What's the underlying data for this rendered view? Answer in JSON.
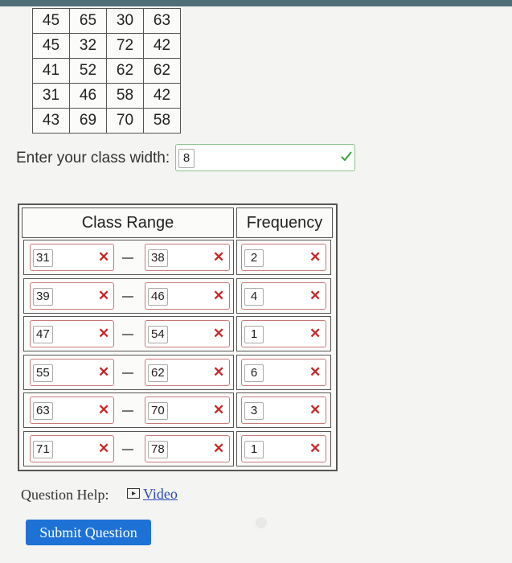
{
  "data_table": {
    "rows": [
      [
        "45",
        "65",
        "30",
        "63"
      ],
      [
        "45",
        "32",
        "72",
        "42"
      ],
      [
        "41",
        "52",
        "62",
        "62"
      ],
      [
        "31",
        "46",
        "58",
        "42"
      ],
      [
        "43",
        "69",
        "70",
        "58"
      ]
    ]
  },
  "class_width": {
    "label": "Enter your class width:",
    "value": "8",
    "status": "correct"
  },
  "freq_table": {
    "headers": {
      "range": "Class Range",
      "frequency": "Frequency"
    },
    "rows": [
      {
        "lower": "31",
        "upper": "38",
        "freq": "2"
      },
      {
        "lower": "39",
        "upper": "46",
        "freq": "4"
      },
      {
        "lower": "47",
        "upper": "54",
        "freq": "1"
      },
      {
        "lower": "55",
        "upper": "62",
        "freq": "6"
      },
      {
        "lower": "63",
        "upper": "70",
        "freq": "3"
      },
      {
        "lower": "71",
        "upper": "78",
        "freq": "1"
      }
    ],
    "x_mark": "✕"
  },
  "help": {
    "label": "Question Help:",
    "video_label": "Video"
  },
  "submit": {
    "label": "Submit Question"
  },
  "colors": {
    "error": "#c62828",
    "success": "#3aa53a",
    "button": "#1e72d6",
    "link": "#2a4bb5"
  }
}
